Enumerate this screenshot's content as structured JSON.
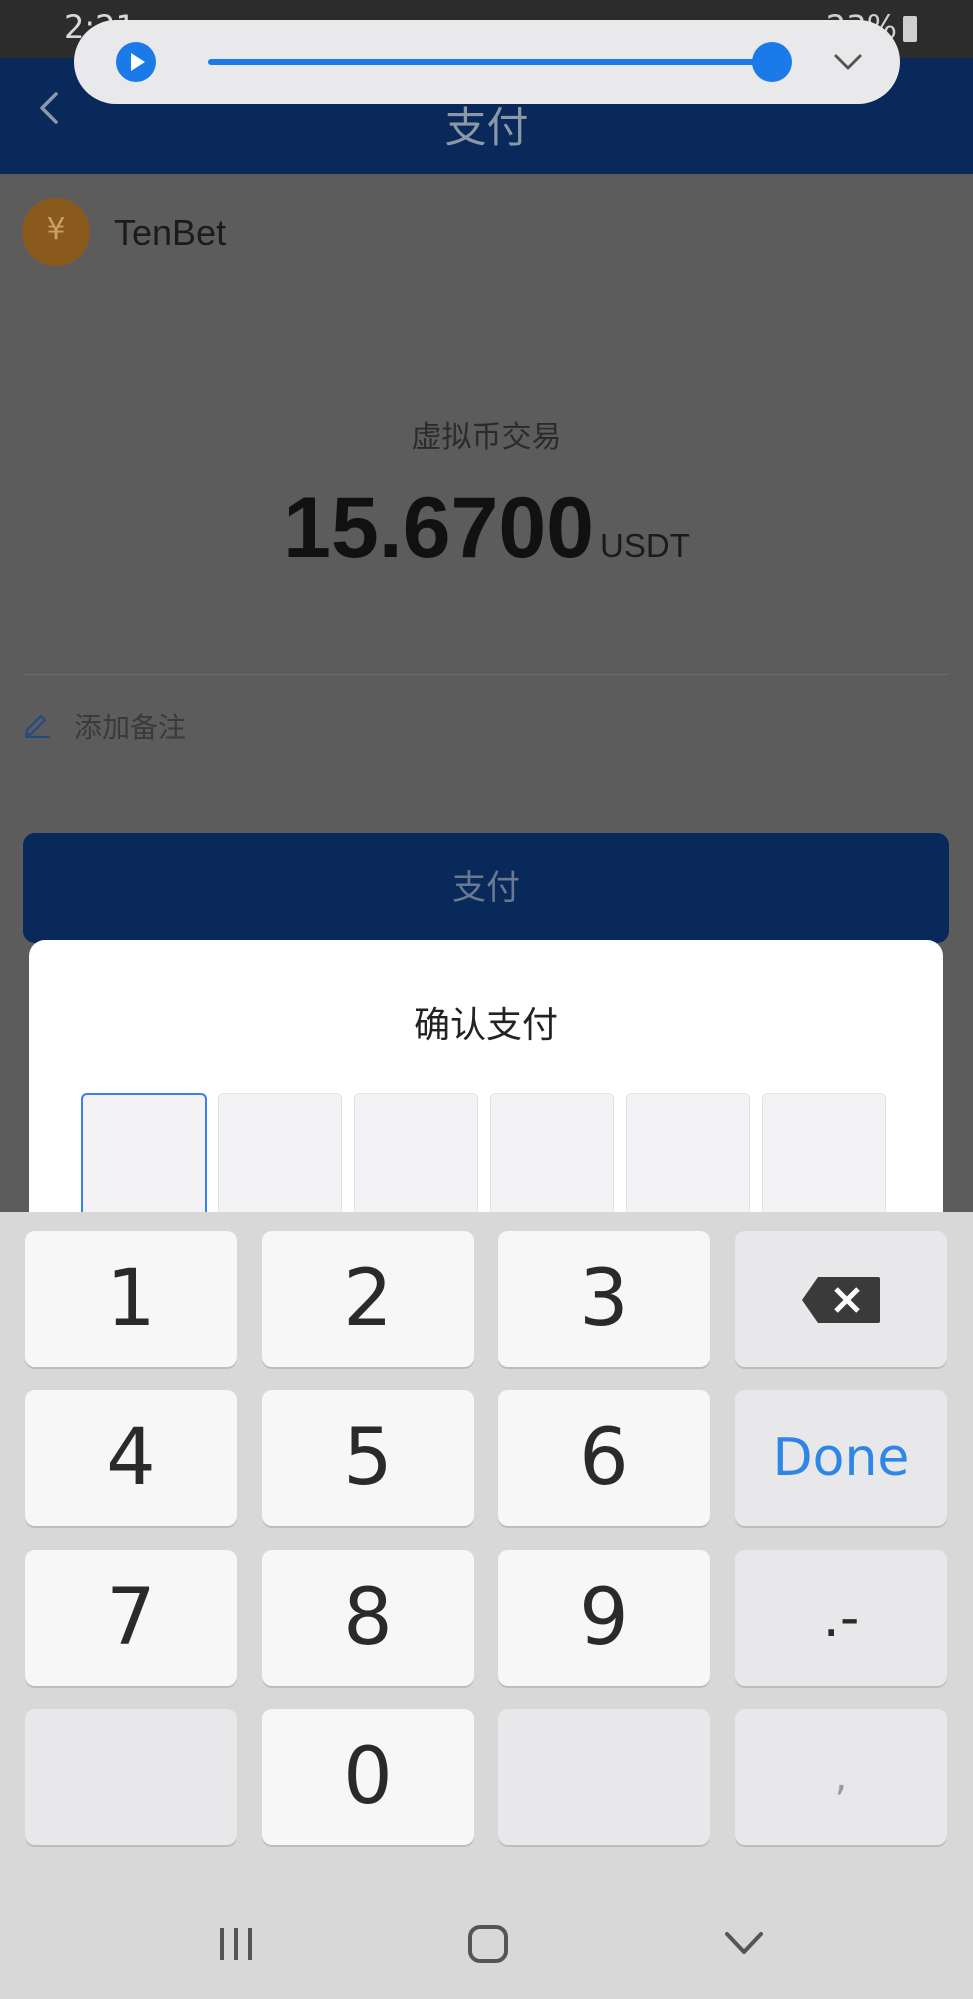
{
  "status_bar": {
    "time": "2:21",
    "battery": "23%"
  },
  "app_bar": {
    "title": "支付"
  },
  "merchant": {
    "logo_glyph": "¥",
    "name": "TenBet"
  },
  "transaction": {
    "type": "虚拟币交易",
    "amount": "15.6700",
    "unit": "USDT"
  },
  "note": {
    "label": "添加备注"
  },
  "pay_button": {
    "label": "支付"
  },
  "confirm_sheet": {
    "title": "确认支付",
    "pin_length": 6
  },
  "keyboard": {
    "row1": [
      "1",
      "2",
      "3"
    ],
    "row2": [
      "4",
      "5",
      "6"
    ],
    "row3": [
      "7",
      "8",
      "9"
    ],
    "zero": "0",
    "done_label": "Done",
    "punct_label": ".-",
    "comma_label": ","
  },
  "media_pill": {
    "progress": 0.98
  },
  "icons": {
    "back": "chevron-left-icon",
    "note": "pencil-icon",
    "backspace": "backspace-icon",
    "play": "play-icon",
    "collapse": "chevron-down-icon",
    "nav_recents": "recents-icon",
    "nav_home": "home-icon",
    "nav_back": "nav-back-icon"
  },
  "colors": {
    "accent": "#1a7be8",
    "primary_dark": "#08295a",
    "done_text": "#2f86e6"
  }
}
